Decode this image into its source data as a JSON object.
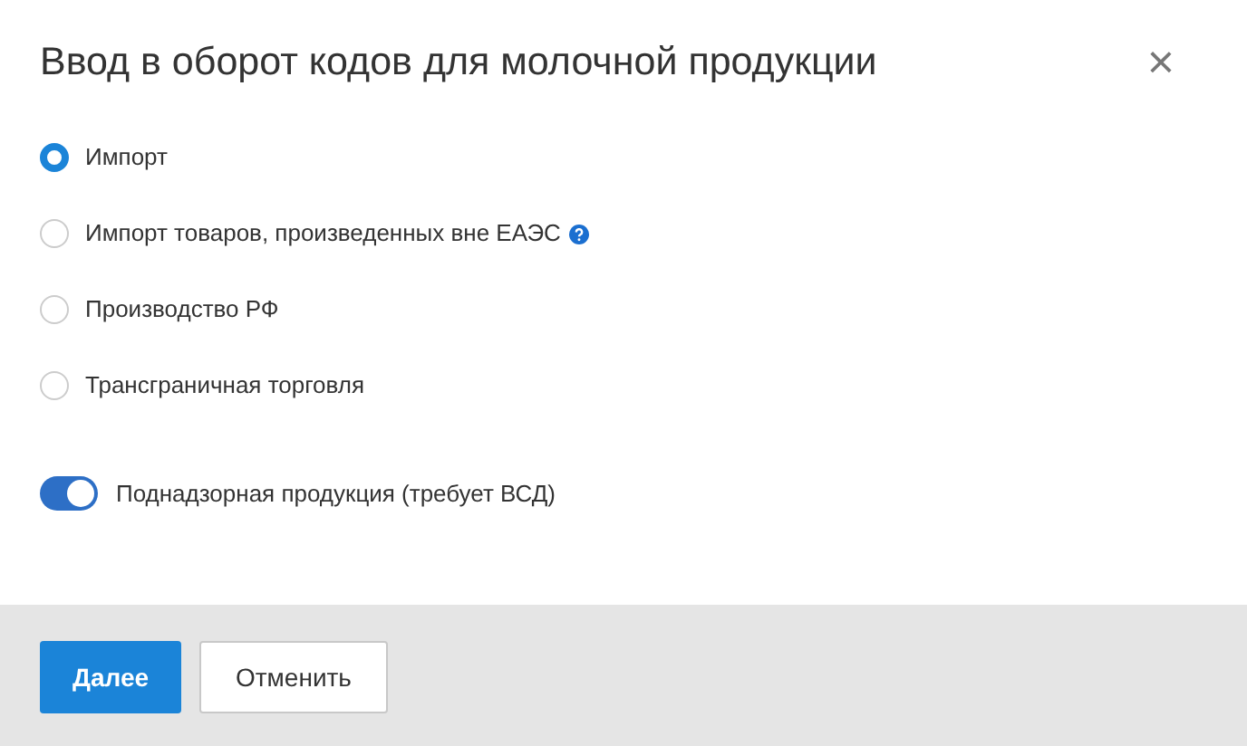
{
  "dialog": {
    "title": "Ввод в оборот кодов для молочной продукции",
    "close": "×"
  },
  "options": [
    {
      "label": "Импорт",
      "selected": true,
      "help": false
    },
    {
      "label": "Импорт товаров, произведенных вне ЕАЭС",
      "selected": false,
      "help": true
    },
    {
      "label": "Производство РФ",
      "selected": false,
      "help": false
    },
    {
      "label": "Трансграничная торговля",
      "selected": false,
      "help": false
    }
  ],
  "toggle": {
    "label": "Поднадзорная продукция (требует ВСД)",
    "on": true
  },
  "buttons": [
    {
      "label": "Далее",
      "kind": "primary"
    },
    {
      "label": "Отменить",
      "kind": "secondary"
    }
  ]
}
